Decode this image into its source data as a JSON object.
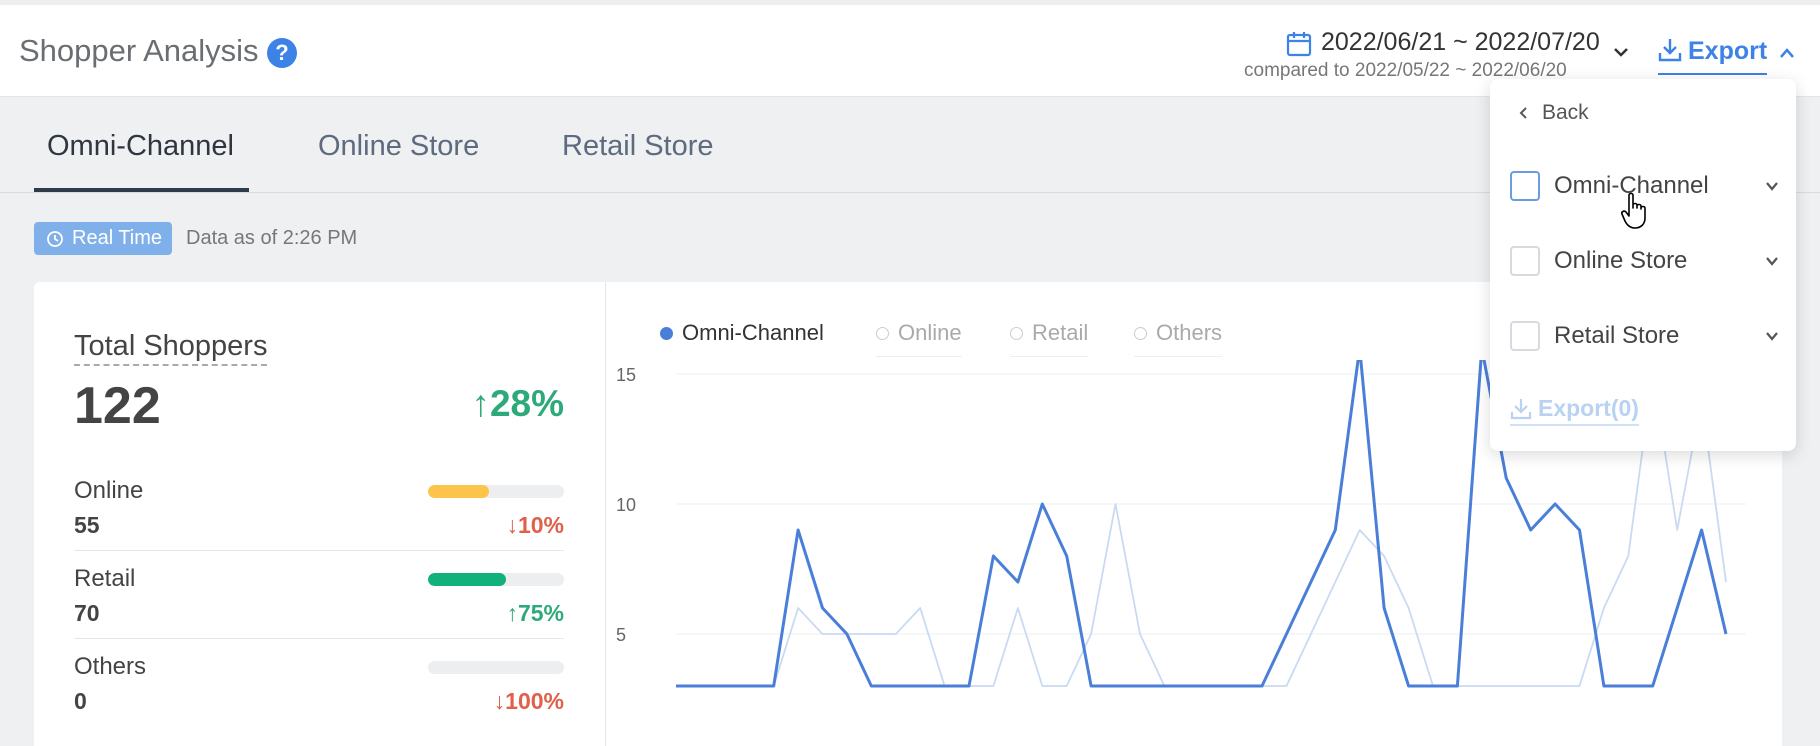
{
  "header": {
    "title": "Shopper Analysis",
    "date_range": "2022/06/21 ~ 2022/07/20",
    "compared_to": "compared to 2022/05/22 ~ 2022/06/20",
    "export_label": "Export"
  },
  "tabs": [
    {
      "label": "Omni-Channel",
      "active": true
    },
    {
      "label": "Online Store",
      "active": false
    },
    {
      "label": "Retail Store",
      "active": false
    }
  ],
  "status": {
    "realtime_label": "Real Time",
    "data_as_of": "Data as of 2:26 PM"
  },
  "summary": {
    "label": "Total Shoppers",
    "value": "122",
    "change": "28%",
    "change_dir": "up",
    "metrics": [
      {
        "name": "Online",
        "value": "55",
        "change": "10%",
        "dir": "down",
        "fill": 0.45,
        "color": "#fcc44b"
      },
      {
        "name": "Retail",
        "value": "70",
        "change": "75%",
        "dir": "up",
        "fill": 0.57,
        "color": "#12b07b"
      },
      {
        "name": "Others",
        "value": "0",
        "change": "100%",
        "dir": "down",
        "fill": 0,
        "color": "#cccccc"
      }
    ]
  },
  "legend": [
    {
      "label": "Omni-Channel",
      "active": true
    },
    {
      "label": "Online",
      "active": false
    },
    {
      "label": "Retail",
      "active": false
    },
    {
      "label": "Others",
      "active": false
    }
  ],
  "dropdown": {
    "back_label": "Back",
    "items": [
      {
        "label": "Omni-Channel",
        "hover": true
      },
      {
        "label": "Online Store",
        "hover": false
      },
      {
        "label": "Retail Store",
        "hover": false
      }
    ],
    "export_label": "Export(0)"
  },
  "chart_data": {
    "type": "line",
    "ylim": [
      5,
      16
    ],
    "y_ticks": [
      15,
      10,
      5
    ],
    "grid": true,
    "series": [
      {
        "name": "Omni-Channel",
        "color": "#4a7fd9",
        "values": [
          3,
          3,
          3,
          3,
          3,
          9,
          6,
          5,
          3,
          3,
          3,
          3,
          3,
          8,
          7,
          10,
          8,
          3,
          3,
          3,
          3,
          3,
          3,
          3,
          3,
          5,
          7,
          9,
          16,
          6,
          3,
          3,
          3,
          16,
          11,
          9,
          10,
          9,
          3,
          3,
          3,
          6,
          9,
          5
        ]
      },
      {
        "name": "Online",
        "color": "#c9daf3",
        "values": [
          3,
          3,
          3,
          3,
          3,
          6,
          5,
          5,
          5,
          5,
          6,
          3,
          3,
          3,
          6,
          3,
          3,
          5,
          10,
          5,
          3,
          3,
          3,
          3,
          3,
          3,
          5,
          7,
          9,
          8,
          6,
          3,
          3,
          3,
          3,
          3,
          3,
          3,
          6,
          8,
          15,
          9,
          14,
          7
        ]
      }
    ]
  }
}
